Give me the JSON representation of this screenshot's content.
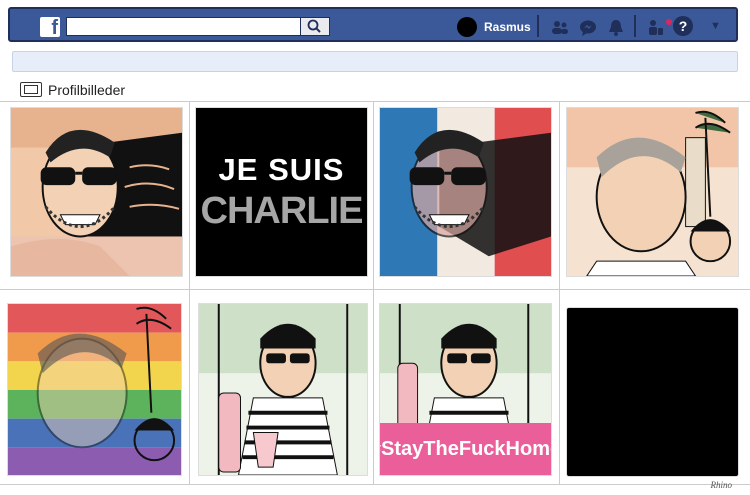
{
  "header": {
    "brand": "f",
    "user_name": "Rasmus",
    "icons": [
      "friends-icon",
      "messenger-icon",
      "bell-icon",
      "group-icon",
      "help-icon"
    ]
  },
  "section": {
    "title": "Profilbilleder",
    "icon": "photo-album-icon"
  },
  "tiles": [
    {
      "kind": "portrait",
      "desc": "Sunglasses selfie by the sea"
    },
    {
      "kind": "text",
      "line1": "JE SUIS",
      "line2": "CHARLIE"
    },
    {
      "kind": "portrait",
      "overlay": "French flag"
    },
    {
      "kind": "portrait",
      "desc": "Man with child and palm trees"
    },
    {
      "kind": "portrait",
      "overlay": "Rainbow flag"
    },
    {
      "kind": "portrait",
      "desc": "Man with rosé bottle and glass"
    },
    {
      "kind": "portrait",
      "caption": "#StayTheFuckHome"
    },
    {
      "kind": "blank"
    }
  ],
  "colors": {
    "topbar": "#3b5998",
    "hashtag_bg": "#ea5f9a",
    "charlie_text": "#ffffff",
    "charlie_gray": "#a6a6a6"
  },
  "signature": "Rhino"
}
